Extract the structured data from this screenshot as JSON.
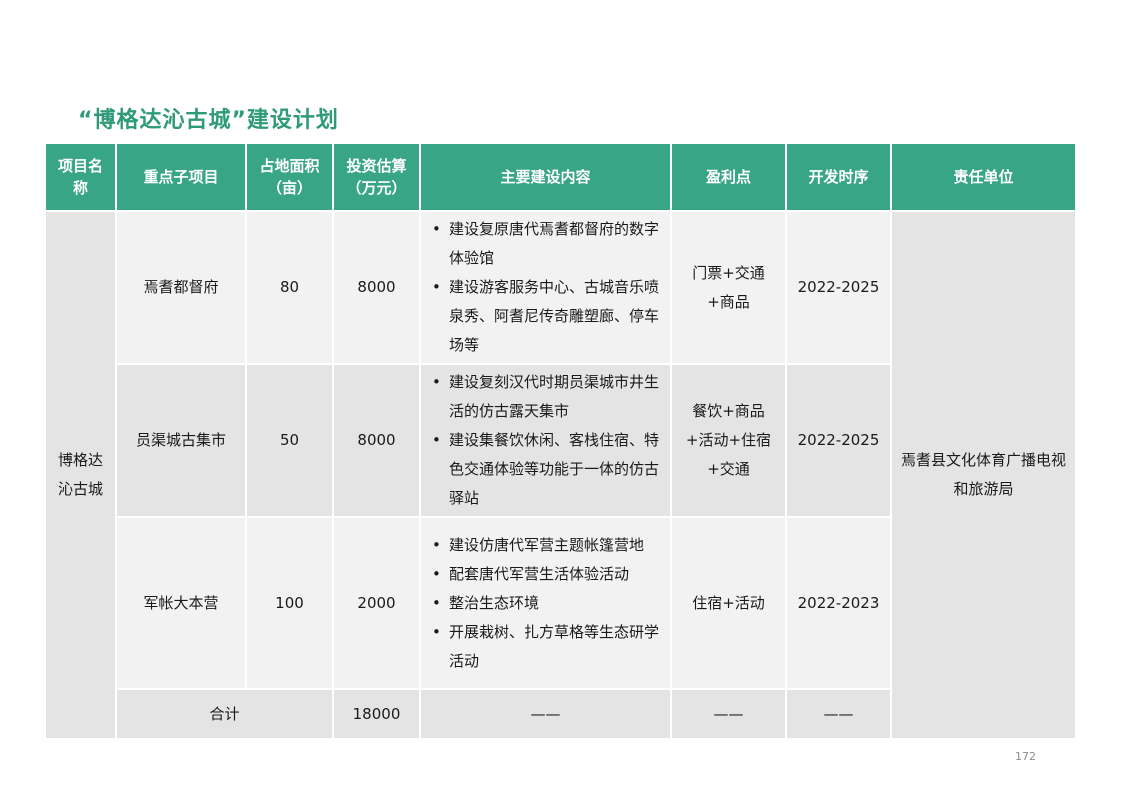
{
  "page": {
    "title": "“博格达沁古城”建设计划",
    "page_number": "172"
  },
  "table": {
    "headers": {
      "project_name": "项目名称",
      "sub_project": "重点子项目",
      "area": "占地面积（亩）",
      "investment": "投资估算（万元）",
      "content": "主要建设内容",
      "profit": "盈利点",
      "schedule": "开发时序",
      "responsible": "责任单位"
    },
    "project_name": "博格达沁古城",
    "responsible": "焉耆县文化体育广播电视和旅游局",
    "rows": [
      {
        "sub_project": "焉耆都督府",
        "area": "80",
        "investment": "8000",
        "content": [
          "建设复原唐代焉耆都督府的数字体验馆",
          "建设游客服务中心、古城音乐喷泉秀、阿耆尼传奇雕塑廊、停车场等"
        ],
        "profit": "门票+交通+商品",
        "schedule": "2022-2025"
      },
      {
        "sub_project": "员渠城古集市",
        "area": "50",
        "investment": "8000",
        "content": [
          "建设复刻汉代时期员渠城市井生活的仿古露天集市",
          "建设集餐饮休闲、客栈住宿、特色交通体验等功能于一体的仿古驿站"
        ],
        "profit": "餐饮+商品+活动+住宿+交通",
        "schedule": "2022-2025"
      },
      {
        "sub_project": "军帐大本营",
        "area": "100",
        "investment": "2000",
        "content": [
          "建设仿唐代军营主题帐篷营地",
          "配套唐代军营生活体验活动",
          "整治生态环境",
          "开展栽树、扎方草格等生态研学活动"
        ],
        "profit": "住宿+活动",
        "schedule": "2022-2023"
      }
    ],
    "total": {
      "label": "合计",
      "investment": "18000",
      "content": "——",
      "profit": "——",
      "schedule": "——"
    }
  }
}
